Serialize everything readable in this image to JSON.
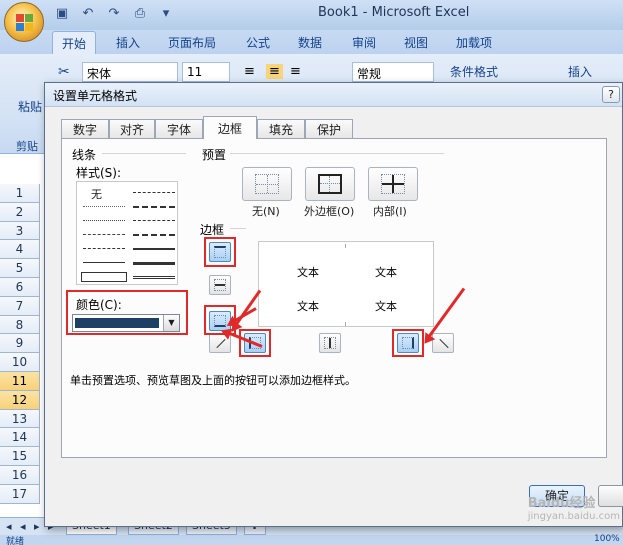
{
  "window": {
    "title": "Book1 - Microsoft Excel"
  },
  "ribbon": {
    "tabs": [
      "开始",
      "插入",
      "页面布局",
      "公式",
      "数据",
      "审阅",
      "视图",
      "加载项"
    ],
    "paste_label": "粘贴",
    "clipboard_label": "剪贴",
    "font_name": "宋体",
    "font_size": "11",
    "number_format": "常规",
    "conditional_format": "条件格式",
    "insert_label": "插入"
  },
  "sheet": {
    "row_numbers": [
      "1",
      "2",
      "3",
      "4",
      "5",
      "6",
      "7",
      "8",
      "9",
      "10",
      "11",
      "12",
      "13",
      "14",
      "15",
      "16",
      "17"
    ],
    "selected_rows": [
      "11",
      "12"
    ],
    "tabs": [
      "Sheet1",
      "Sheet2",
      "Sheet3"
    ],
    "status_left": "就绪",
    "zoom": "100%"
  },
  "dialog": {
    "title": "设置单元格格式",
    "help": "?",
    "tabs": [
      "数字",
      "对齐",
      "字体",
      "边框",
      "填充",
      "保护"
    ],
    "active_tab": "边框",
    "line_group": "线条",
    "style_label": "样式(S):",
    "style_none": "无",
    "color_label": "颜色(C):",
    "color_value": "#1f3f64",
    "presets_group": "预置",
    "presets": [
      "无(N)",
      "外边框(O)",
      "内部(I)"
    ],
    "border_group": "边框",
    "preview_text": [
      "文本",
      "文本",
      "文本",
      "文本"
    ],
    "hint": "单击预置选项、预览草图及上面的按钮可以添加边框样式。",
    "ok_label": "确定"
  },
  "watermark": {
    "main": "Baidu经验",
    "url": "jingyan.baidu.com"
  },
  "colors": {
    "highlight": "#e02a2a",
    "ribbon": "#dfe8f5",
    "dialog_bg": "#f0f0f0"
  }
}
